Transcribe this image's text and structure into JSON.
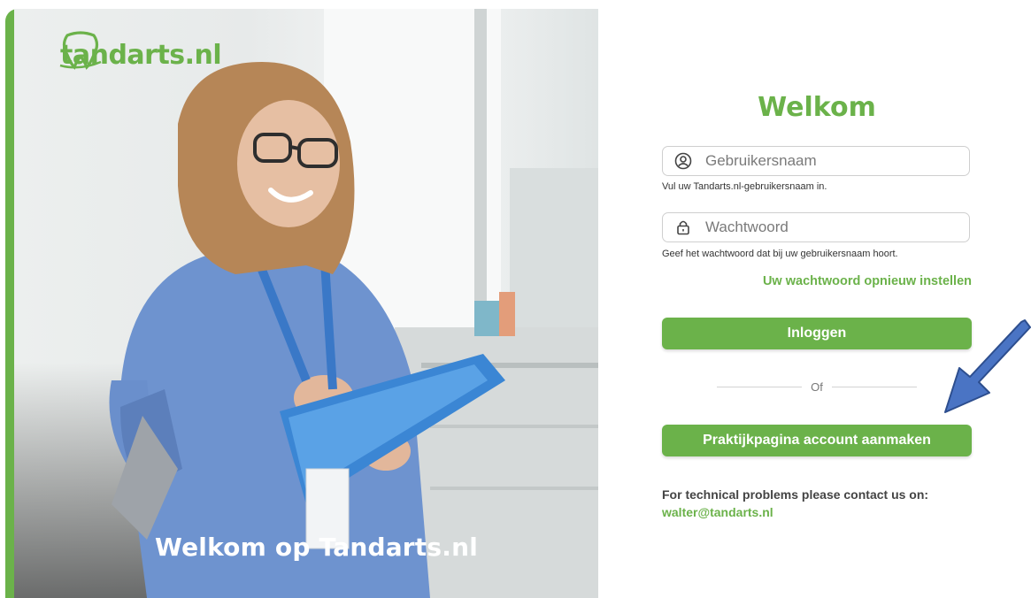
{
  "brand": {
    "name": "tandarts.nl",
    "hero_title": "Welkom op Tandarts.nl"
  },
  "login": {
    "title": "Welkom",
    "username": {
      "placeholder": "Gebruikersnaam",
      "value": "",
      "hint": "Vul uw Tandarts.nl-gebruikersnaam in."
    },
    "password": {
      "placeholder": "Wachtwoord",
      "value": "",
      "hint": "Geef het wachtwoord dat bij uw gebruikersnaam hoort."
    },
    "reset_link": "Uw wachtwoord opnieuw instellen",
    "login_button": "Inloggen",
    "divider_text": "Of",
    "create_account_button": "Praktijkpagina account aanmaken",
    "support_text": "For technical problems please contact us on:",
    "support_email": "walter@tandarts.nl"
  },
  "icons": {
    "username": "user-icon",
    "password": "lock-icon",
    "logo": "tooth-icon",
    "annotation": "blue-arrow-icon"
  },
  "colors": {
    "brand_green": "#6bb24a",
    "annotation_blue": "#4a74c4"
  }
}
